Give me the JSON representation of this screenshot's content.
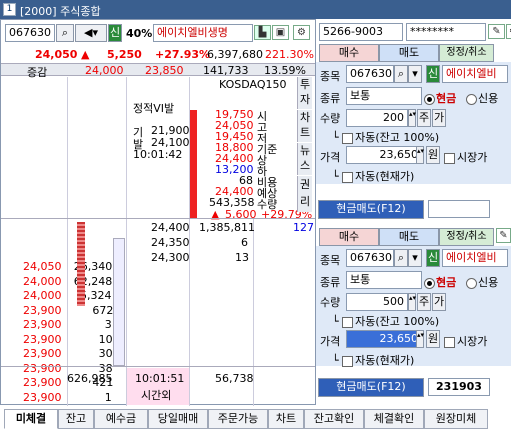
{
  "window": {
    "screen_no": "[2000]",
    "title": "주식종합"
  },
  "left": {
    "code": "067630",
    "pct": "40%",
    "name": "에이치엘비생명",
    "price": "24,050",
    "change_arrow": "▲",
    "change": "5,250",
    "change_pct": "+27.93%",
    "volume": "6,397,680",
    "turnover": "221.30%",
    "hdr": {
      "label": "증감",
      "v1": "24,000",
      "v2": "23,850",
      "v3": "141,733",
      "v4": "13.59%"
    },
    "info": {
      "static_vi": "정적VI발",
      "gi_label": "기",
      "gi": "21,900",
      "bal_label": "발",
      "bal": "24,100",
      "time": "10:01:42"
    },
    "market": "KOSDAQ150",
    "stats": [
      [
        "19,750",
        "시"
      ],
      [
        "24,050",
        "고"
      ],
      [
        "19,450",
        "저"
      ],
      [
        "18,800",
        "기준"
      ],
      [
        "24,400",
        "상"
      ],
      [
        "13,200",
        "하"
      ],
      [
        "68",
        "비용"
      ],
      [
        "24,400",
        "예상"
      ],
      [
        "543,358",
        "수량"
      ]
    ],
    "exp_change_arrow": "▲",
    "exp_change": "5,600",
    "exp_pct": "+29.79%",
    "vtabs": [
      "투자",
      "차트",
      "뉴스",
      "권리"
    ],
    "ask_rows": [],
    "mid": {
      "p1": "24,400",
      "v1": "1,385,811",
      "q1": "127",
      "p2": "24,350",
      "v2": "6",
      "p3": "24,300",
      "v3": "13"
    },
    "bids": [
      [
        "24,050",
        "26,340"
      ],
      [
        "24,000",
        "62,248"
      ],
      [
        "24,000",
        "5,324"
      ],
      [
        "23,900",
        "672"
      ],
      [
        "23,900",
        "3"
      ],
      [
        "23,900",
        "10"
      ],
      [
        "23,900",
        "30"
      ],
      [
        "23,900",
        "38"
      ],
      [
        "23,900",
        "421"
      ],
      [
        "23,900",
        "1"
      ]
    ],
    "totals": {
      "bid_total": "626,985",
      "time": "10:01:51",
      "time_label": "시간외",
      "ask_total": "56,738"
    }
  },
  "right": {
    "account": "5266-9003",
    "password": "********",
    "panel1": {
      "tabs": [
        "매수",
        "매도",
        "정정/취소"
      ],
      "code": "067630",
      "name": "에이치엘비",
      "type": "보통",
      "cash": "현금",
      "credit": "신용",
      "qty": "200",
      "qty_lbl1": "주",
      "qty_lbl2": "가",
      "auto_bal": "자동(잔고 100%)",
      "price": "23,650",
      "unit": "원",
      "market": "시장가",
      "auto_cur": "자동(현재가)",
      "submit": "현금매도(F12)"
    },
    "panel2": {
      "tabs": [
        "매수",
        "매도",
        "정정/취소"
      ],
      "code": "067630",
      "name": "에이치엘비",
      "type": "보통",
      "cash": "현금",
      "credit": "신용",
      "qty": "500",
      "qty_lbl1": "주",
      "qty_lbl2": "가",
      "auto_bal": "자동(잔고 100%)",
      "price": "23,650",
      "unit": "원",
      "market": "시장가",
      "auto_cur": "자동(현재가)",
      "submit": "현금매도(F12)",
      "order_no": "231903"
    },
    "labels": {
      "code": "종목",
      "type": "종류",
      "qty": "수량",
      "price": "가격",
      "ci": "신"
    }
  },
  "bottom_tabs": [
    "미체결",
    "잔고",
    "예수금",
    "당일매매",
    "주문가능",
    "차트",
    "잔고확인",
    "체결확인",
    "원장미체"
  ]
}
